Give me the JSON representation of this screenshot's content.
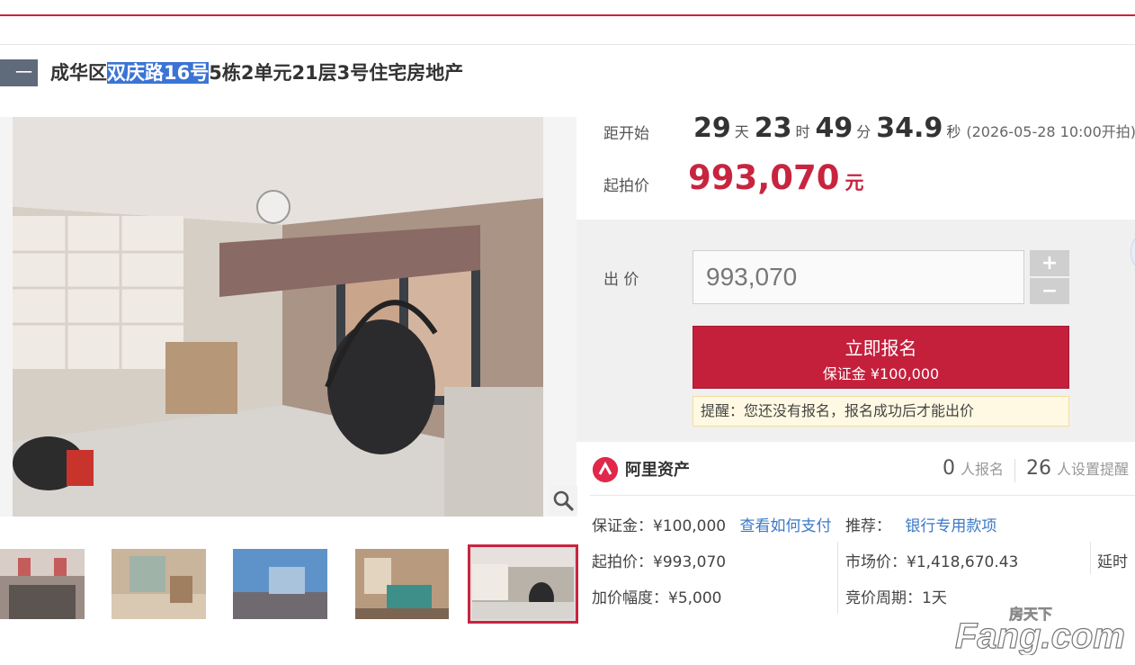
{
  "listing": {
    "badge": "一拍",
    "title_prefix": "成华区",
    "title_highlight": "双庆路16号",
    "title_suffix": "5栋2单元21层3号住宅房地产"
  },
  "countdown": {
    "label": "距开始",
    "days": "29",
    "days_unit": "天",
    "hours": "23",
    "hours_unit": "时",
    "minutes": "49",
    "minutes_unit": "分",
    "seconds": "34.9",
    "seconds_unit": "秒",
    "start_note": "(2026-05-28 10:00开拍)"
  },
  "start_price": {
    "label": "起拍价",
    "value": "993,070",
    "unit": "元"
  },
  "bid": {
    "label": "出 价",
    "input_value": "993,070",
    "plus": "+",
    "minus": "−",
    "signup_label": "立即报名",
    "deposit_line": "保证金 ¥100,000",
    "reminder": "提醒：您还没有报名，报名成功后才能出价"
  },
  "platform": {
    "name": "阿里资产",
    "signups_count": "0",
    "signups_label": "人报名",
    "reminders_count": "26",
    "reminders_label": "人设置提醒"
  },
  "details": {
    "deposit": "保证金：¥100,000",
    "pay_link": "查看如何支付",
    "recommend_label": "推荐：",
    "recommend_link": "银行专用款项",
    "start_price": "起拍价：¥993,070",
    "market_price": "市场价：¥1,418,670.43",
    "delay": "延时",
    "increment": "加价幅度：¥5,000",
    "cycle": "竞价周期：1天"
  },
  "watermark": {
    "cn": "房天下",
    "en": "Fang.com"
  },
  "colors": {
    "accent": "#c4203c",
    "link": "#3c78c8",
    "badge": "#5f6b7a"
  }
}
